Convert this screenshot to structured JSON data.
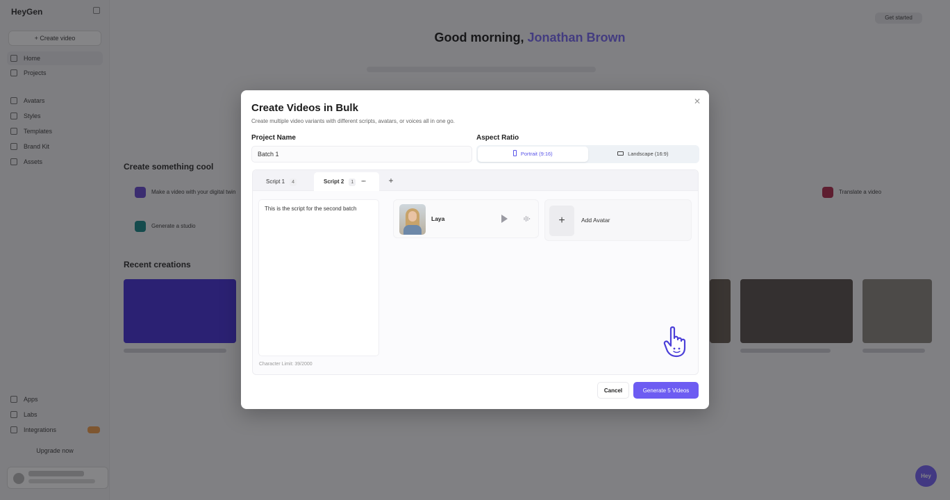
{
  "background": {
    "app_name": "HeyGen",
    "create_button": "+ Create video",
    "nav": [
      {
        "label": "Home",
        "icon": "home-icon"
      },
      {
        "label": "Projects",
        "icon": "folder-icon"
      },
      {
        "label": "Avatars",
        "icon": "user-icon"
      },
      {
        "label": "Styles",
        "icon": "palette-icon"
      },
      {
        "label": "Templates",
        "icon": "grid-icon"
      },
      {
        "label": "Brand Kit",
        "icon": "brand-icon"
      },
      {
        "label": "Assets",
        "icon": "box-icon"
      }
    ],
    "bottom_nav": [
      {
        "label": "Apps",
        "icon": "apps-icon"
      },
      {
        "label": "Labs",
        "icon": "flask-icon"
      },
      {
        "label": "Integrations",
        "icon": "plug-icon"
      }
    ],
    "upgrade_label": "Upgrade now",
    "topbar_button": "Get started",
    "greeting_prefix": "Good morning,",
    "greeting_name": "Jonathan Brown",
    "section_create": "Create something cool",
    "section_recent": "Recent creations",
    "quick_cards": [
      "Make a video with your digital twin",
      "Generate a studio",
      "Translate a video"
    ],
    "help_label": "Hey"
  },
  "modal": {
    "title": "Create Videos in Bulk",
    "subtitle": "Create multiple video variants with different scripts, avatars, or voices all in one go.",
    "project_name_label": "Project Name",
    "project_name_value": "Batch 1",
    "aspect_ratio_label": "Aspect Ratio",
    "aspect_options": [
      {
        "label": "Portrait (9:16)",
        "selected": true
      },
      {
        "label": "Landscape (16:9)",
        "selected": false
      }
    ],
    "tabs": [
      {
        "label": "Script 1",
        "count": "4",
        "active": false
      },
      {
        "label": "Script 2",
        "count": "1",
        "active": true
      }
    ],
    "more_glyph": "···",
    "add_tab_glyph": "+",
    "script_text": "This is the script for the second batch",
    "char_limit": "Character Limit: 39/2000",
    "avatars": [
      {
        "name": "Laya"
      }
    ],
    "add_avatar_label": "Add Avatar",
    "cancel_label": "Cancel",
    "generate_label": "Generate 5 Videos",
    "colors": {
      "accent": "#6d5cf2",
      "selected_text": "#5a55e8"
    }
  }
}
